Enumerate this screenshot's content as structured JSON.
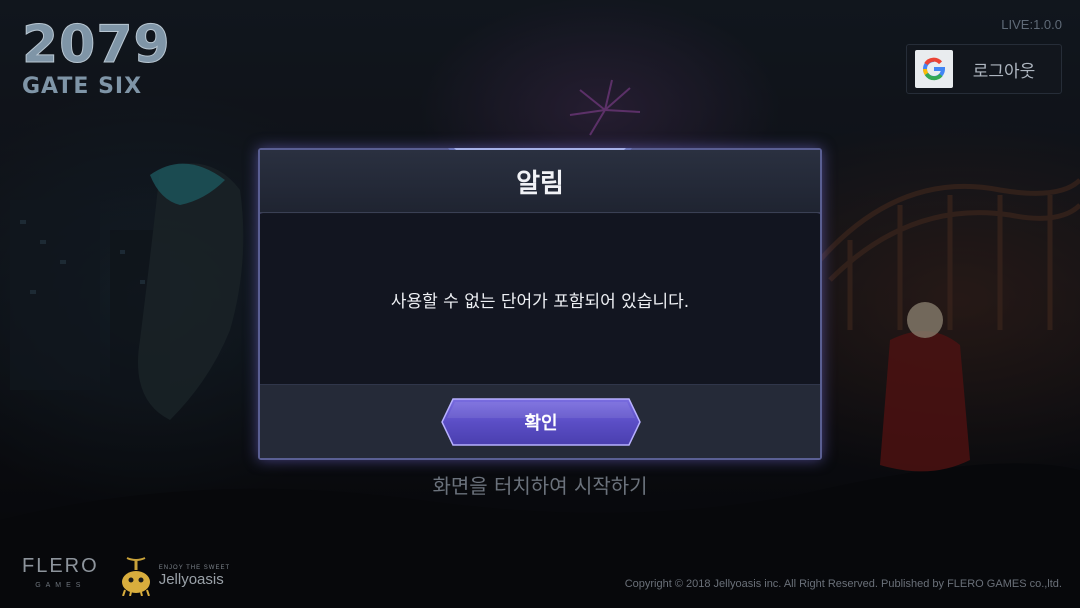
{
  "game": {
    "logo_number": "2079",
    "logo_subtitle": "GATE SIX",
    "version": "LIVE:1.0.0"
  },
  "account": {
    "logout_label": "로그아웃",
    "provider_icon": "google-g-icon"
  },
  "start_prompt": "화면을 터치하여 시작하기",
  "dialog": {
    "title": "알림",
    "message": "사용할 수 없는 단어가 포함되어 있습니다.",
    "confirm_label": "확인"
  },
  "footer": {
    "publisher_logo": "FLERO",
    "publisher_logo_sub": "GAMES",
    "developer_tagline": "ENJOY THE SWEET",
    "developer_name": "Jellyoasis",
    "copyright": "Copyright © 2018 Jellyoasis inc. All Right Reserved. Published by FLERO GAMES co.,ltd."
  },
  "colors": {
    "accent_purple": "#5a4fc2",
    "dialog_border": "#5a5f93",
    "background": "#101218"
  }
}
